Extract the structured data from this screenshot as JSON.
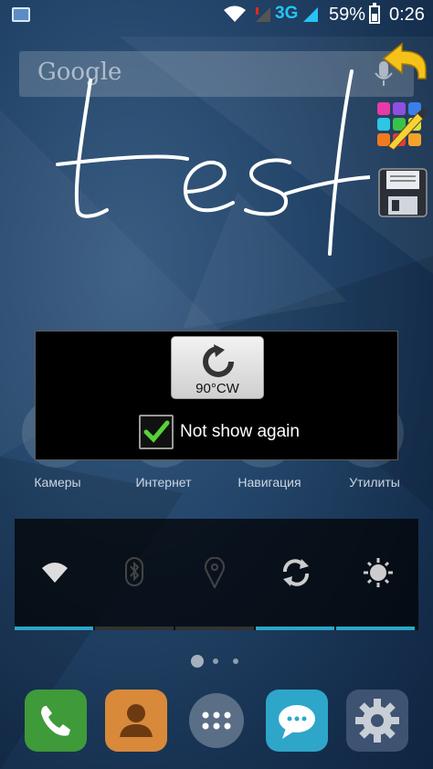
{
  "status_bar": {
    "network": "3G",
    "battery_percent": "59%",
    "battery_level": 0.59,
    "time": "0:26"
  },
  "search": {
    "placeholder": "Google"
  },
  "popup": {
    "rotate_button_label": "90°CW",
    "checkbox_label": "Not show again",
    "checkbox_checked": true
  },
  "handwriting": "test",
  "folders": [
    {
      "label": "Камеры"
    },
    {
      "label": "Интернет"
    },
    {
      "label": "Навигация"
    },
    {
      "label": "Утилиты"
    }
  ],
  "power_widget": {
    "toggles": [
      {
        "icon": "wifi-icon",
        "active": true
      },
      {
        "icon": "bluetooth-icon",
        "active": false
      },
      {
        "icon": "location-icon",
        "active": false
      },
      {
        "icon": "sync-icon",
        "active": true
      },
      {
        "icon": "brightness-icon",
        "active": true
      }
    ]
  },
  "page_indicator": {
    "pages": 3,
    "current": 1
  },
  "dock": [
    {
      "icon": "phone-icon",
      "color": "#3f9a3a"
    },
    {
      "icon": "contacts-icon",
      "color": "#d8893a"
    },
    {
      "icon": "app-drawer-icon",
      "color": "#5a6f86"
    },
    {
      "icon": "messaging-icon",
      "color": "#2ea6c9"
    },
    {
      "icon": "settings-icon",
      "color": "#3e5371"
    }
  ],
  "colors": {
    "accent_3g": "#27c3f5",
    "widget_active_bar": "#2aa6c9",
    "widget_inactive_bar": "#333333"
  }
}
